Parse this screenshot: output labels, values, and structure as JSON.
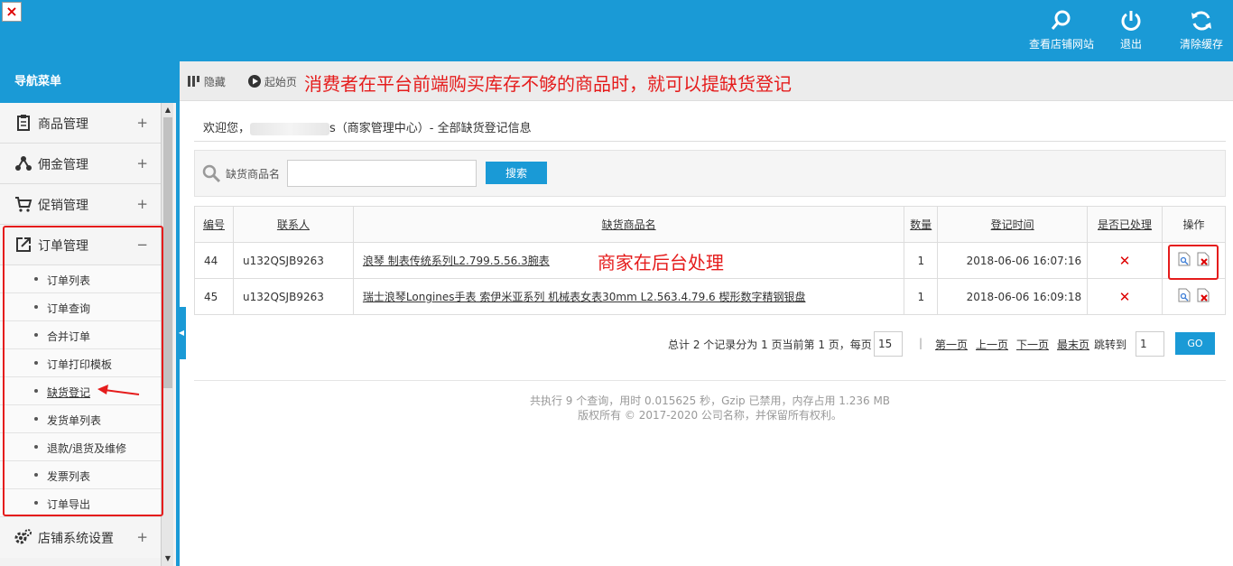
{
  "topbar": {
    "close_glyph": "×",
    "buttons": [
      {
        "label": "查看店铺网站",
        "icon": "search-icon"
      },
      {
        "label": "退出",
        "icon": "power-icon"
      },
      {
        "label": "清除缓存",
        "icon": "refresh-icon"
      }
    ]
  },
  "sidebar": {
    "title": "导航菜单",
    "groups_top": [
      {
        "label": "商品管理",
        "toggle": "+"
      },
      {
        "label": "佣金管理",
        "toggle": "+"
      },
      {
        "label": "促销管理",
        "toggle": "+"
      }
    ],
    "order_group": {
      "label": "订单管理",
      "toggle": "−"
    },
    "order_items": [
      "订单列表",
      "订单查询",
      "合并订单",
      "订单打印模板",
      "缺货登记",
      "发货单列表",
      "退款/退货及维修",
      "发票列表",
      "订单导出"
    ],
    "active_item": "缺货登记",
    "bottom_group": {
      "label": "店铺系统设置",
      "toggle": "+"
    }
  },
  "toolbar": {
    "hide_label": "隐藏",
    "home_label": "起始页",
    "annotation": "消费者在平台前端购买库存不够的商品时，就可以提缺货登记"
  },
  "welcome": {
    "prefix": "欢迎您，",
    "suffix": "s（商家管理中心）- 全部缺货登记信息"
  },
  "search": {
    "label": "缺货商品名",
    "value": "",
    "button": "搜索"
  },
  "table": {
    "headers": [
      "编号",
      "联系人",
      "缺货商品名",
      "数量",
      "登记时间",
      "是否已处理",
      "操作"
    ],
    "rows": [
      {
        "id": "44",
        "contact": "u132QSJB9263",
        "product": "浪琴 制表传统系列L2.799.5.56.3腕表",
        "qty": "1",
        "time": "2018-06-06 16:07:16",
        "processed": "✕"
      },
      {
        "id": "45",
        "contact": "u132QSJB9263",
        "product": "瑞士浪琴Longines手表 索伊米亚系列 机械表女表30mm L2.563.4.79.6 楔形数字精钢银盘",
        "qty": "1",
        "time": "2018-06-06 16:09:18",
        "processed": "✕"
      }
    ],
    "annotation": "商家在后台处理"
  },
  "pager": {
    "summary": "总计 2 个记录分为 1 页当前第 1 页，每页",
    "per_page": "15",
    "first": "第一页",
    "prev": "上一页",
    "next": "下一页",
    "last": "最末页",
    "jump_label": "跳转到",
    "jump_value": "1",
    "go": "GO"
  },
  "footer": {
    "line1": "共执行 9 个查询，用时 0.015625 秒，Gzip 已禁用，内存占用 1.236 MB",
    "line2": "版权所有 © 2017-2020 公司名称，并保留所有权利。"
  },
  "colors": {
    "brand": "#1a9ad6",
    "annotation": "#e51c1c"
  }
}
